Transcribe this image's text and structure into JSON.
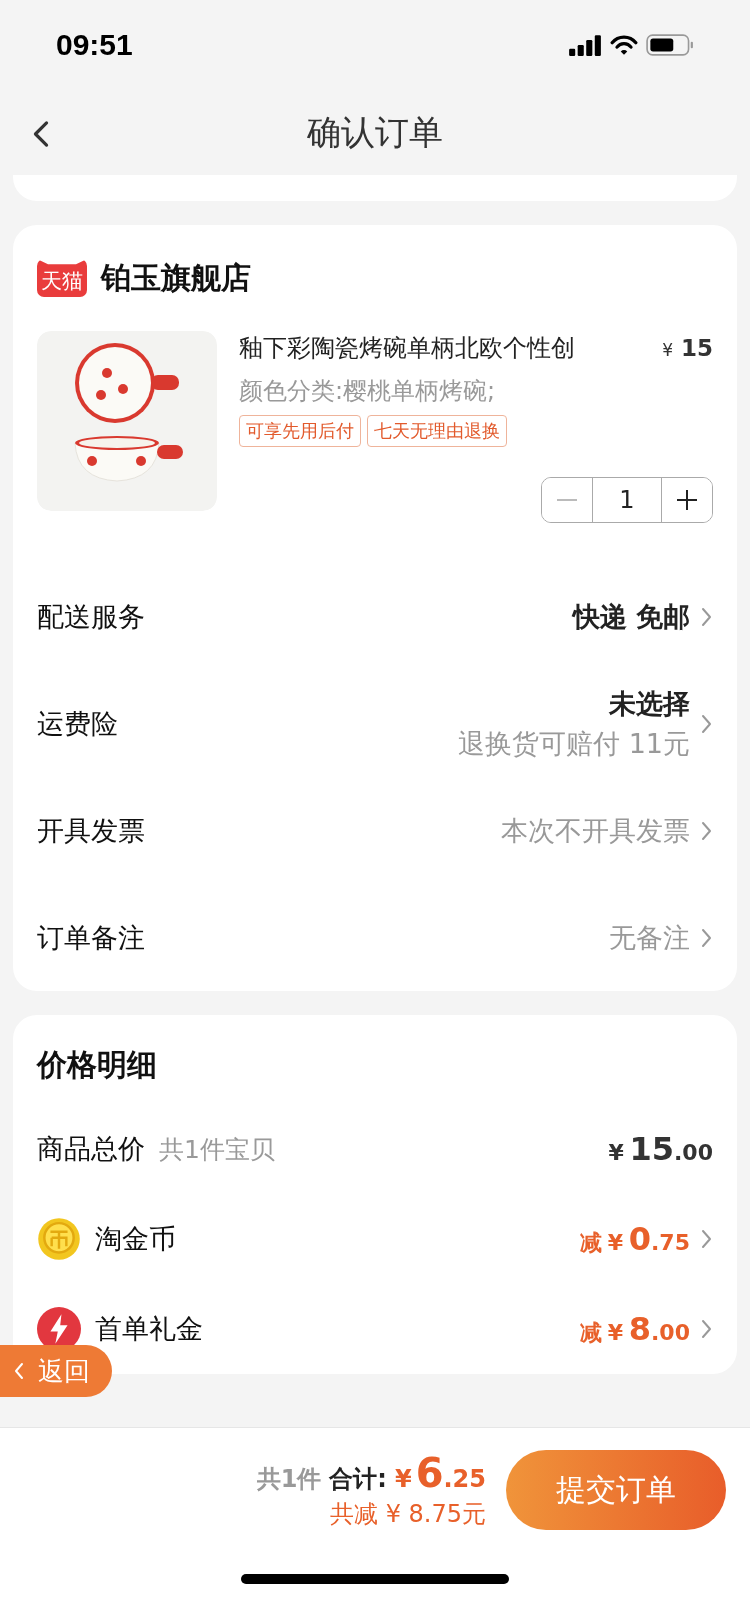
{
  "status_bar": {
    "time": "09:51"
  },
  "nav": {
    "title": "确认订单"
  },
  "store": {
    "badge": "天猫",
    "name": "铂玉旗舰店"
  },
  "product": {
    "title": "釉下彩陶瓷烤碗单柄北欧个性创",
    "currency": "¥",
    "price": "15",
    "spec": "颜色分类:樱桃单柄烤碗;",
    "tags": [
      "可享先用后付",
      "七天无理由退换"
    ],
    "quantity": "1",
    "minus_disabled": true
  },
  "services": [
    {
      "label": "配送服务",
      "value": "快递 免邮",
      "kind": "strong"
    },
    {
      "label": "运费险",
      "value": "未选择",
      "subvalue": "退换货可赔付 11元",
      "kind": "strong"
    },
    {
      "label": "开具发票",
      "value": "本次不开具发票",
      "kind": "muted"
    },
    {
      "label": "订单备注",
      "value": "无备注",
      "kind": "muted"
    }
  ],
  "price_detail": {
    "title": "价格明细",
    "rows": [
      {
        "label": "商品总价",
        "note": "共1件宝贝",
        "kind": "total",
        "currency": "¥",
        "integer": "15",
        "decimal": ".00",
        "chevron": false
      },
      {
        "label": "淘金币",
        "kind": "discount",
        "prefix": "减",
        "currency": "¥",
        "integer": "0",
        "decimal": ".75",
        "chevron": true
      },
      {
        "label": "首单礼金",
        "kind": "discount",
        "prefix": "减",
        "currency": "¥",
        "integer": "8",
        "decimal": ".00",
        "chevron": true
      }
    ]
  },
  "float_back": {
    "label": "返回"
  },
  "footer": {
    "count": "共1件",
    "total_label": "合计:",
    "currency": "¥",
    "integer": "6",
    "decimal": ".25",
    "saved": "共减 ¥ 8.75元",
    "submit": "提交订单"
  }
}
